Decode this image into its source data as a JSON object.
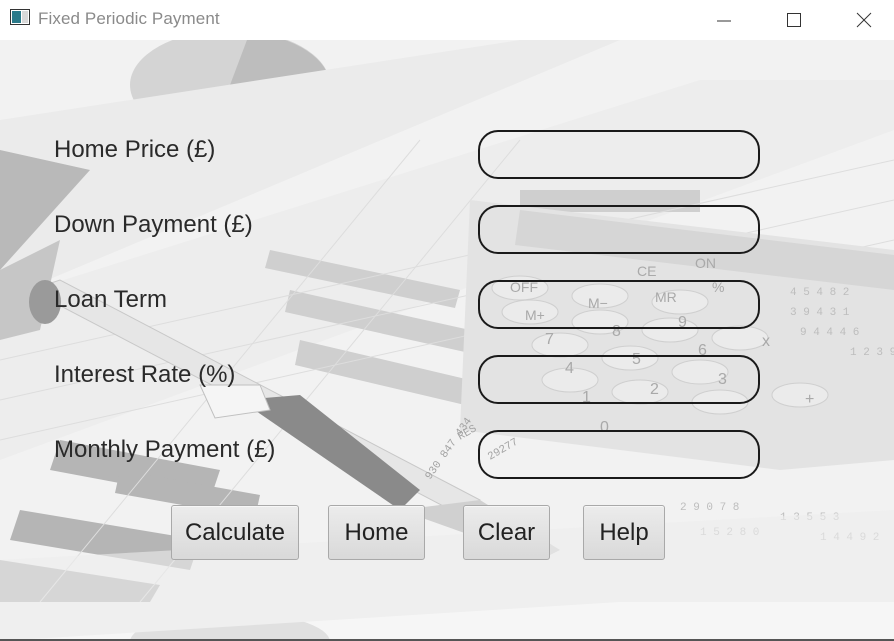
{
  "window": {
    "title": "Fixed Periodic Payment",
    "icon": "java-app-icon"
  },
  "form": {
    "fields": [
      {
        "label": "Home Price (£)",
        "value": ""
      },
      {
        "label": "Down Payment (£)",
        "value": ""
      },
      {
        "label": "Loan Term",
        "value": ""
      },
      {
        "label": "Interest Rate (%)",
        "value": ""
      },
      {
        "label": "Monthly Payment (£)",
        "value": ""
      }
    ]
  },
  "buttons": {
    "calculate": "Calculate",
    "home": "Home",
    "clear": "Clear",
    "help": "Help"
  },
  "background": {
    "description_icon": "finance-calculator-background",
    "calculator_keys": [
      "OFF",
      "CE",
      "ON",
      "M+",
      "M-",
      "MR",
      "%",
      "7",
      "8",
      "9",
      "4",
      "5",
      "6",
      "1",
      "2",
      "3",
      "0",
      "x",
      "+",
      "-"
    ]
  }
}
